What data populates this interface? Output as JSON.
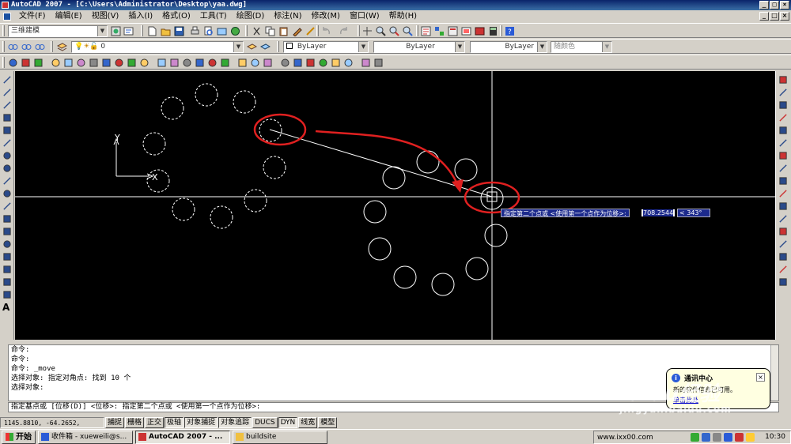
{
  "window": {
    "title": "AutoCAD 2007 - [C:\\Users\\Administrator\\Desktop\\yaa.dwg]",
    "controls": [
      "_",
      "□",
      "×"
    ]
  },
  "menu": {
    "items": [
      "文件(F)",
      "编辑(E)",
      "视图(V)",
      "插入(I)",
      "格式(O)",
      "工具(T)",
      "绘图(D)",
      "标注(N)",
      "修改(M)",
      "窗口(W)",
      "帮助(H)"
    ]
  },
  "toolbar": {
    "workspace": "三维建模",
    "layer": "0",
    "color": "ByLayer",
    "linetype": "ByLayer",
    "lineweight": "ByLayer",
    "plotstyle": "随颜色"
  },
  "drawing": {
    "ucs_x_label": "X",
    "ucs_y_label": "Y",
    "dynamic_input": {
      "prompt": "指定第二个点或 <使用第一个点作为位移>:",
      "distance": "708.2544",
      "angle": "< 343°"
    },
    "colors": {
      "background": "#000000",
      "geometry": "#ffffff",
      "highlight": "#e02020",
      "crosshair": "#ffffff"
    }
  },
  "command": {
    "history": [
      "命令:",
      "命令:",
      "命令: _move",
      "选择对象: 指定对角点: 找到 10 个",
      "选择对象:"
    ],
    "current": "指定基点或 [位移(D)] <位移>:  指定第二个点或 <使用第一个点作为位移>:"
  },
  "status": {
    "coords": "1145.8810,  -64.2652,  0.0000",
    "buttons": [
      {
        "label": "捕捉",
        "pressed": false
      },
      {
        "label": "栅格",
        "pressed": false
      },
      {
        "label": "正交",
        "pressed": false
      },
      {
        "label": "极轴",
        "pressed": true
      },
      {
        "label": "对象捕捉",
        "pressed": true
      },
      {
        "label": "对象追踪",
        "pressed": true
      },
      {
        "label": "DUCS",
        "pressed": false
      },
      {
        "label": "DYN",
        "pressed": true
      },
      {
        "label": "线宽",
        "pressed": false
      },
      {
        "label": "模型",
        "pressed": false
      }
    ]
  },
  "notification": {
    "title": "通讯中心",
    "text": "新的软件信息已可用。",
    "link": "单击此处"
  },
  "taskbar": {
    "start": "开始",
    "tasks": [
      {
        "label": "收件箱 - xueweili@s...",
        "active": false
      },
      {
        "label": "AutoCAD 2007 - ...",
        "active": true
      },
      {
        "label": "buildsite",
        "active": false
      }
    ],
    "tray_url": "www.ixx00.com",
    "clock": "10:30"
  },
  "watermark": {
    "line1": "Baidu经验",
    "line2": "jingyan.baidu.com"
  }
}
